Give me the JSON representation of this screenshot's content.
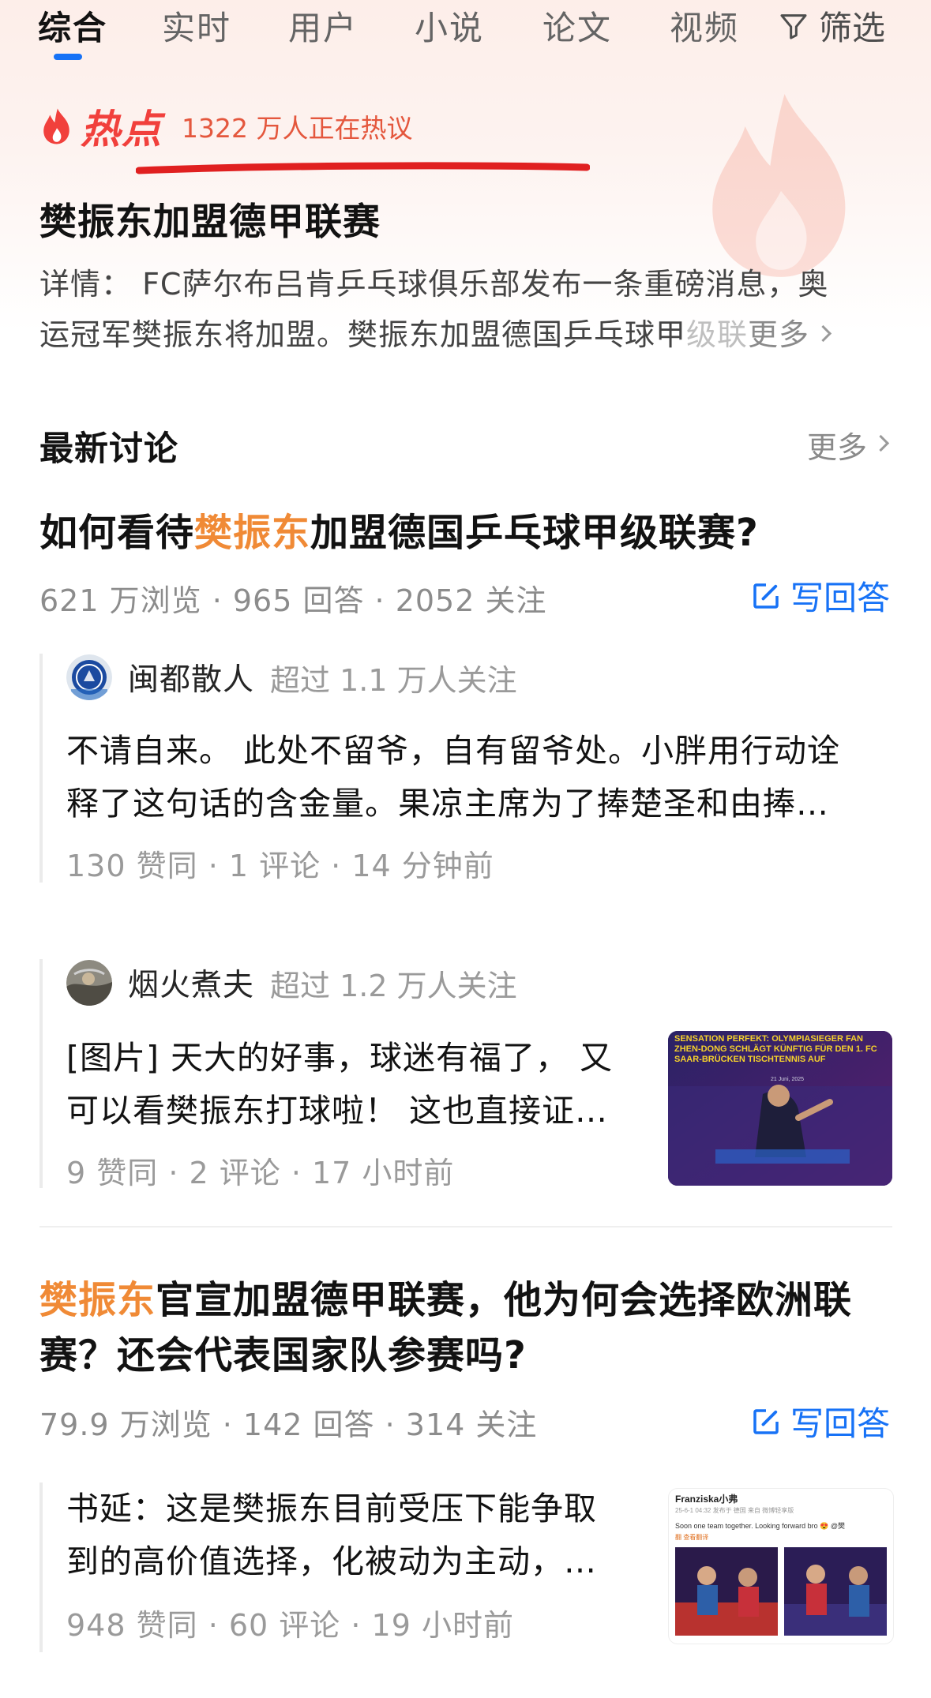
{
  "tabs": [
    "综合",
    "实时",
    "用户",
    "小说",
    "论文",
    "视频"
  ],
  "filter_label": "筛选",
  "hot": {
    "label": "热点",
    "count_text": "1322 万人正在热议",
    "title": "樊振东加盟德甲联赛",
    "detail_line1": "详情：  FC萨尔布吕肯乒乓球俱乐部发布一条重磅消息，奥",
    "detail_line2_main": "运冠军樊振东将加盟。樊振东加盟德国乒乓球甲",
    "detail_line2_fade": "级联",
    "more": "更多"
  },
  "latest": {
    "title": "最新讨论",
    "more": "更多"
  },
  "questions": [
    {
      "title_prefix": "如何看待",
      "title_highlight": "樊振东",
      "title_suffix": "加盟德国乒乓球甲级联赛?",
      "meta": "621 万浏览 · 965 回答 · 2052 关注",
      "write": "写回答",
      "answers": [
        {
          "author": "闽都散人",
          "follow": "超过 1.1 万人关注",
          "line1": "不请自来。 此处不留爷，自有留爷处。小胖用行动诠",
          "line2": "释了这句话的含金量。果凉主席为了捧楚圣和由捧…",
          "meta": "130 赞同 · 1 评论 · 14 分钟前",
          "avatar_icon": "chelsea-badge-icon"
        },
        {
          "author": "烟火煮夫",
          "follow": "超过 1.2 万人关注",
          "line1": "[图片] 天大的好事，球迷有福了， 又",
          "line2": "可以看樊振东打球啦！ 这也直接证…",
          "meta": "9 赞同 · 2 评论 · 17 小时前",
          "thumb_heading": "SENSATION PERFEKT: OLYMPIASIEGER FAN ZHEN-DONG SCHLÄGT KÜNFTIG FÜR DEN 1. FC SAAR-BRÜCKEN TISCHTENNIS AUF",
          "thumb_date": "21 Juni, 2025"
        }
      ]
    },
    {
      "title_line1_highlight": "樊振东",
      "title_line1_rest": "官宣加盟德甲联赛，他为何会选择欧洲联",
      "title_line2": "赛？还会代表国家队参赛吗?",
      "meta": "79.9 万浏览 · 142 回答 · 314 关注",
      "write": "写回答",
      "answers": [
        {
          "line1": "书延：这是樊振东目前受压下能争取",
          "line2": "到的高价值选择，化被动为主动，…",
          "meta": "948 赞同 · 60 评论 · 19 小时前",
          "thumb_user": "Franziska小弗",
          "thumb_sub": "25-6-1 04:32 发布于 德国 来自 微博轻享版",
          "thumb_text": "Soon one team together. Looking forward bro 😍 @樊",
          "thumb_translate": "翻 查看翻译"
        }
      ]
    }
  ],
  "colors": {
    "accent": "#1772f6",
    "hot": "#f1403c",
    "highlight": "#f08a36",
    "underline_annotation": "#e02020"
  }
}
